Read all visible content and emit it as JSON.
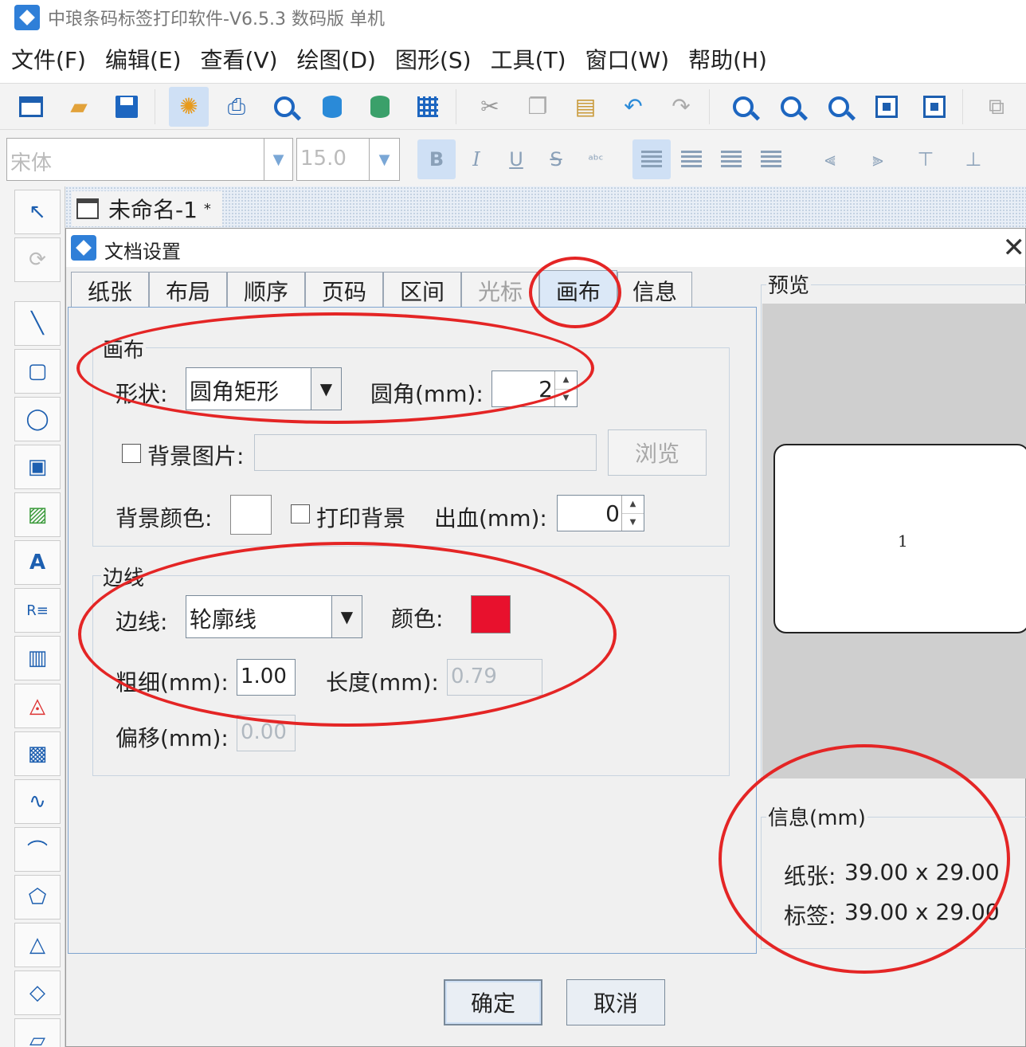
{
  "window": {
    "title": "中琅条码标签打印软件-V6.5.3 数码版 单机"
  },
  "menu": [
    "文件(F)",
    "编辑(E)",
    "查看(V)",
    "绘图(D)",
    "图形(S)",
    "工具(T)",
    "窗口(W)",
    "帮助(H)"
  ],
  "format_bar": {
    "font": "宋体",
    "size": "15.0",
    "bold": "B",
    "italic": "I",
    "underline": "U",
    "strike": "S"
  },
  "document_tab": {
    "label": "未命名-1",
    "modified": "*"
  },
  "dialog": {
    "title": "文档设置",
    "close": "X",
    "tabs": [
      "纸张",
      "布局",
      "顺序",
      "页码",
      "区间",
      "光标",
      "画布",
      "信息"
    ],
    "active_tab": "画布",
    "disabled_tab": "光标",
    "canvas_group": {
      "title": "画布",
      "shape_label": "形状:",
      "shape_value": "圆角矩形",
      "corner_label": "圆角(mm):",
      "corner_value": "2",
      "bg_image_label": "背景图片:",
      "browse": "浏览",
      "bg_color_label": "背景颜色:",
      "bg_color": "#ffffff",
      "print_bg_label": "打印背景",
      "bleed_label": "出血(mm):",
      "bleed_value": "0"
    },
    "border_group": {
      "title": "边线",
      "border_label": "边线:",
      "border_value": "轮廓线",
      "color_label": "颜色:",
      "color": "#e8112d",
      "thickness_label": "粗细(mm):",
      "thickness_value": "1.00",
      "length_label": "长度(mm):",
      "length_value": "0.79",
      "offset_label": "偏移(mm):",
      "offset_value": "0.00"
    },
    "preview": {
      "title": "预览",
      "label_number": "1"
    },
    "info": {
      "title": "信息(mm)",
      "paper_label": "纸张:",
      "paper_value": "39.00 x 29.00",
      "label_label": "标签:",
      "label_value": "39.00 x 29.00"
    },
    "buttons": {
      "ok": "确定",
      "cancel": "取消"
    }
  }
}
